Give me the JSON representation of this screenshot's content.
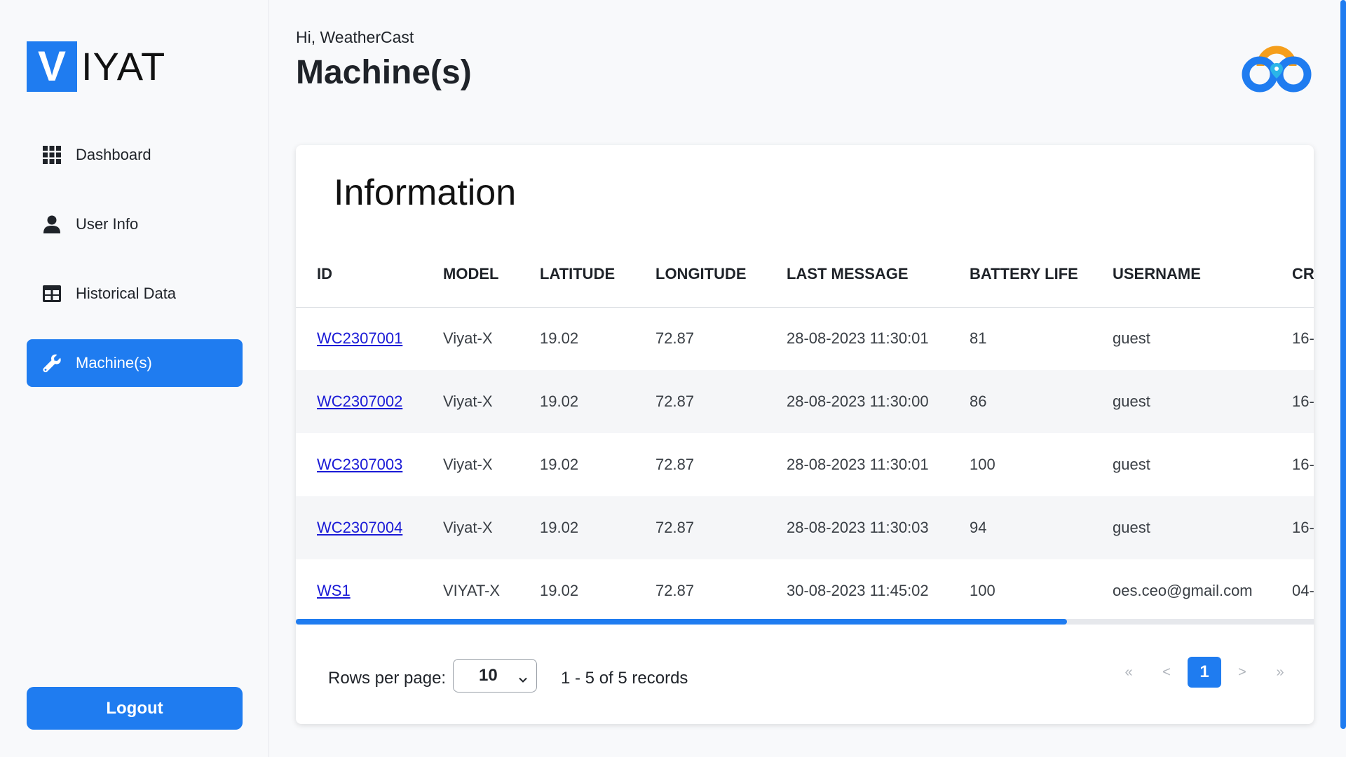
{
  "sidebar": {
    "logo_letter": "V",
    "logo_text": "IYAT",
    "items": [
      {
        "label": "Dashboard",
        "icon": "grid-icon"
      },
      {
        "label": "User Info",
        "icon": "user-icon"
      },
      {
        "label": "Historical Data",
        "icon": "table-icon"
      },
      {
        "label": "Machine(s)",
        "icon": "wrench-icon",
        "active": true
      }
    ],
    "logout_label": "Logout"
  },
  "header": {
    "greeting": "Hi, WeatherCast",
    "title": "Machine(s)"
  },
  "card": {
    "title": "Information",
    "columns": [
      "ID",
      "MODEL",
      "LATITUDE",
      "LONGITUDE",
      "LAST MESSAGE",
      "BATTERY LIFE",
      "USERNAME",
      "CR"
    ],
    "rows": [
      [
        "WC2307001",
        "Viyat-X",
        "19.02",
        "72.87",
        "28-08-2023 11:30:01",
        "81",
        "guest",
        "16-"
      ],
      [
        "WC2307002",
        "Viyat-X",
        "19.02",
        "72.87",
        "28-08-2023 11:30:00",
        "86",
        "guest",
        "16-"
      ],
      [
        "WC2307003",
        "Viyat-X",
        "19.02",
        "72.87",
        "28-08-2023 11:30:01",
        "100",
        "guest",
        "16-"
      ],
      [
        "WC2307004",
        "Viyat-X",
        "19.02",
        "72.87",
        "28-08-2023 11:30:03",
        "94",
        "guest",
        "16-"
      ],
      [
        "WS1",
        "VIYAT-X",
        "19.02",
        "72.87",
        "30-08-2023 11:45:02",
        "100",
        "oes.ceo@gmail.com",
        "04-"
      ]
    ]
  },
  "pagination": {
    "rows_per_page_label": "Rows per page:",
    "rows_per_page_value": "10",
    "records_text": "1 - 5 of 5 records",
    "first": "«",
    "prev": "<",
    "current_page": "1",
    "next": ">",
    "last": "»"
  },
  "colors": {
    "accent": "#1f7cf0",
    "link": "#1a1ad6"
  }
}
